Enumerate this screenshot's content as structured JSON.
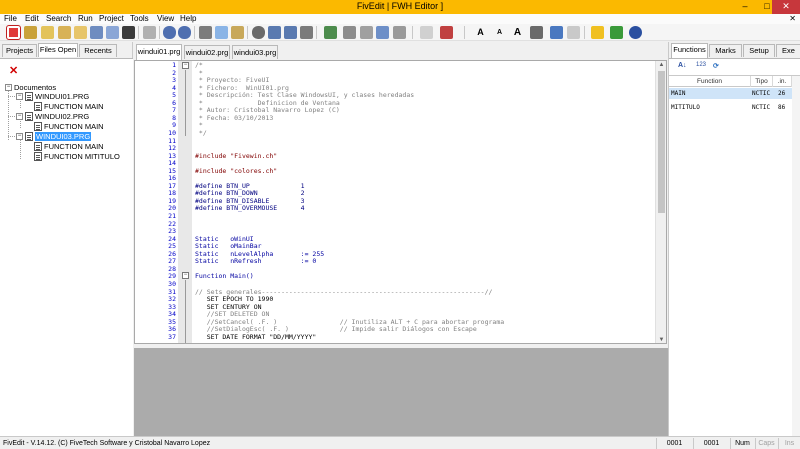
{
  "window": {
    "title": "FivEdit | FWH Editor ]",
    "minimize": "–",
    "maximize": "□",
    "close": "✕"
  },
  "menu": {
    "items": [
      "File",
      "Edit",
      "Search",
      "Run",
      "Project",
      "Tools",
      "View",
      "Help"
    ],
    "mdi_close": "✕"
  },
  "left_panel": {
    "tabs": [
      "Projects",
      "Files Open",
      "Recents"
    ],
    "active_tab": "Files Open",
    "close_glyph": "✕",
    "tree": {
      "root": "Documentos",
      "files": [
        {
          "name": "WINDUI01.PRG",
          "functions": [
            "FUNCTION MAIN"
          ]
        },
        {
          "name": "WINDUI02.PRG",
          "functions": [
            "FUNCTION MAIN"
          ]
        },
        {
          "name": "WINDUI03.PRG",
          "functions": [
            "FUNCTION MAIN",
            "FUNCTION MITITULO"
          ],
          "selected": true
        }
      ]
    }
  },
  "editor": {
    "tabs": [
      "windui01.prg",
      "windui02.prg",
      "windui03.prg"
    ],
    "active_tab": "windui01.prg",
    "lines": [
      {
        "n": "1",
        "text": "/*",
        "cls": "c-comment"
      },
      {
        "n": "2",
        "text": " *",
        "cls": "c-comment"
      },
      {
        "n": "3",
        "text": " * Proyecto: FiveUI",
        "cls": "c-comment"
      },
      {
        "n": "4",
        "text": " * Fichero:  WinUI01.prg",
        "cls": "c-comment"
      },
      {
        "n": "5",
        "text": " * Descripción: Test Clase WindowsUI, y clases heredadas",
        "cls": "c-comment"
      },
      {
        "n": "6",
        "text": " *              Definicion de Ventana",
        "cls": "c-comment"
      },
      {
        "n": "7",
        "text": " * Autor: Cristobal Navarro Lopez (C)",
        "cls": "c-comment"
      },
      {
        "n": "8",
        "text": " * Fecha: 03/10/2013",
        "cls": "c-comment"
      },
      {
        "n": "9",
        "text": " *",
        "cls": "c-comment"
      },
      {
        "n": "10",
        "text": " */",
        "cls": "c-comment"
      },
      {
        "n": "11",
        "text": "",
        "cls": "c-default"
      },
      {
        "n": "12",
        "text": "",
        "cls": "c-default"
      },
      {
        "n": "13",
        "text": "#include \"Fivewin.ch\"",
        "cls": "c-string"
      },
      {
        "n": "14",
        "text": "",
        "cls": "c-default"
      },
      {
        "n": "15",
        "text": "#include \"colores.ch\"",
        "cls": "c-string"
      },
      {
        "n": "16",
        "text": "",
        "cls": "c-default"
      },
      {
        "n": "17",
        "text": "#define BTN_UP             1",
        "cls": "c-define"
      },
      {
        "n": "18",
        "text": "#define BTN_DOWN           2",
        "cls": "c-define"
      },
      {
        "n": "19",
        "text": "#define BTN_DISABLE        3",
        "cls": "c-define"
      },
      {
        "n": "20",
        "text": "#define BTN_OVERMOUSE      4",
        "cls": "c-define"
      },
      {
        "n": "21",
        "text": "",
        "cls": "c-default"
      },
      {
        "n": "22",
        "text": "",
        "cls": "c-default"
      },
      {
        "n": "23",
        "text": "",
        "cls": "c-default"
      },
      {
        "n": "24",
        "text": "Static   oWinUI",
        "cls": "c-keyword"
      },
      {
        "n": "25",
        "text": "Static   oMainBar",
        "cls": "c-keyword"
      },
      {
        "n": "26",
        "text": "Static   nLevelAlpha       := 255",
        "cls": "c-keyword"
      },
      {
        "n": "27",
        "text": "Static   nRefresh          := 0",
        "cls": "c-keyword"
      },
      {
        "n": "28",
        "text": "",
        "cls": "c-default"
      },
      {
        "n": "29",
        "text": "Function Main()",
        "cls": "c-keyword"
      },
      {
        "n": "30",
        "text": "",
        "cls": "c-default"
      },
      {
        "n": "31",
        "text": "// Sets generales---------------------------------------------------------//",
        "cls": "c-comment"
      },
      {
        "n": "32",
        "text": "   SET EPOCH TO 1990",
        "cls": "c-default"
      },
      {
        "n": "33",
        "text": "   SET CENTURY ON",
        "cls": "c-default"
      },
      {
        "n": "34",
        "text": "   //SET DELETED ON",
        "cls": "c-comment"
      },
      {
        "n": "35",
        "text": "   //SetCancel( .F. )                // Inutiliza ALT + C para abortar programa",
        "cls": "c-comment"
      },
      {
        "n": "36",
        "text": "   //SetDialogEsc( .F. )             // Impide salir Diálogos con Escape",
        "cls": "c-comment"
      },
      {
        "n": "37",
        "text": "   SET DATE FORMAT \"DD/MM/YYYY\"",
        "cls": "c-default"
      }
    ]
  },
  "right_panel": {
    "tabs": [
      "Functions",
      "Marks",
      "Setup",
      "Exe"
    ],
    "active_tab": "Functions",
    "tools": [
      "A↓",
      "123",
      "⟳"
    ],
    "columns": [
      "Function",
      "Tipo",
      ".in."
    ],
    "rows": [
      {
        "name": "MAIN",
        "tipo": "NCTIC",
        "line": "26"
      },
      {
        "name": "MITITULO",
        "tipo": "NCTIC",
        "line": "86"
      }
    ]
  },
  "status": {
    "text": "FivEdit - V.14.12. (C) FiveTech Software y Cristobal Navarro Lopez",
    "row": "0001",
    "col": "0001",
    "num": "Num",
    "caps": "Caps",
    "ins": "Ins"
  },
  "colors": {
    "title_bar": "#fbb900",
    "close_button": "#c7373c",
    "selection": "#3399ff",
    "bottom_panel": "#ababab"
  }
}
